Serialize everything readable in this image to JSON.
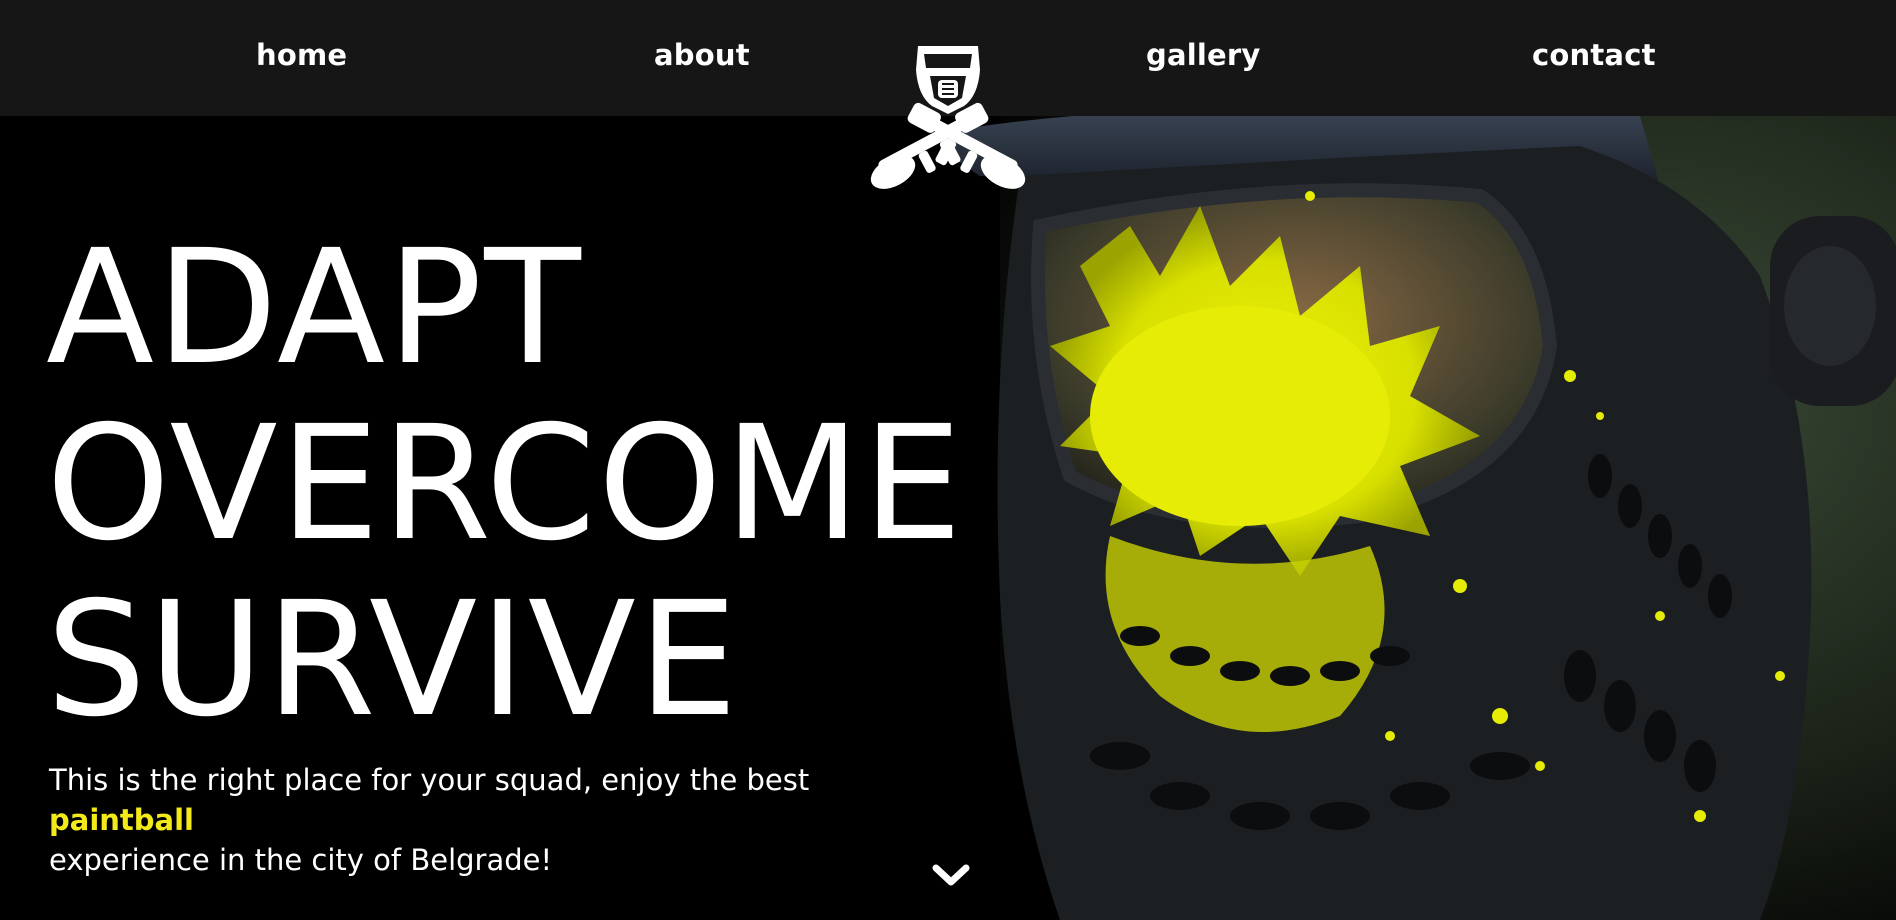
{
  "nav": {
    "links": [
      {
        "label": "home"
      },
      {
        "label": "about"
      },
      {
        "label": "gallery"
      },
      {
        "label": "contact"
      }
    ],
    "logo_icon": "paintball-mask-crossed-markers-icon"
  },
  "hero": {
    "headline": [
      "ADAPT",
      "OVERCOME",
      "SURVIVE"
    ],
    "text_before": "This is the right place for your squad, enjoy the best ",
    "text_accent": "paintball",
    "text_after": "experience in the city of Belgrade!",
    "photo_icon": "paintball-mask-splatter-photo",
    "scroll_icon": "chevron-down-icon"
  },
  "colors": {
    "nav_bg": "#161616",
    "page_bg": "#000000",
    "text": "#ffffff",
    "accent": "#f3ea1a"
  }
}
